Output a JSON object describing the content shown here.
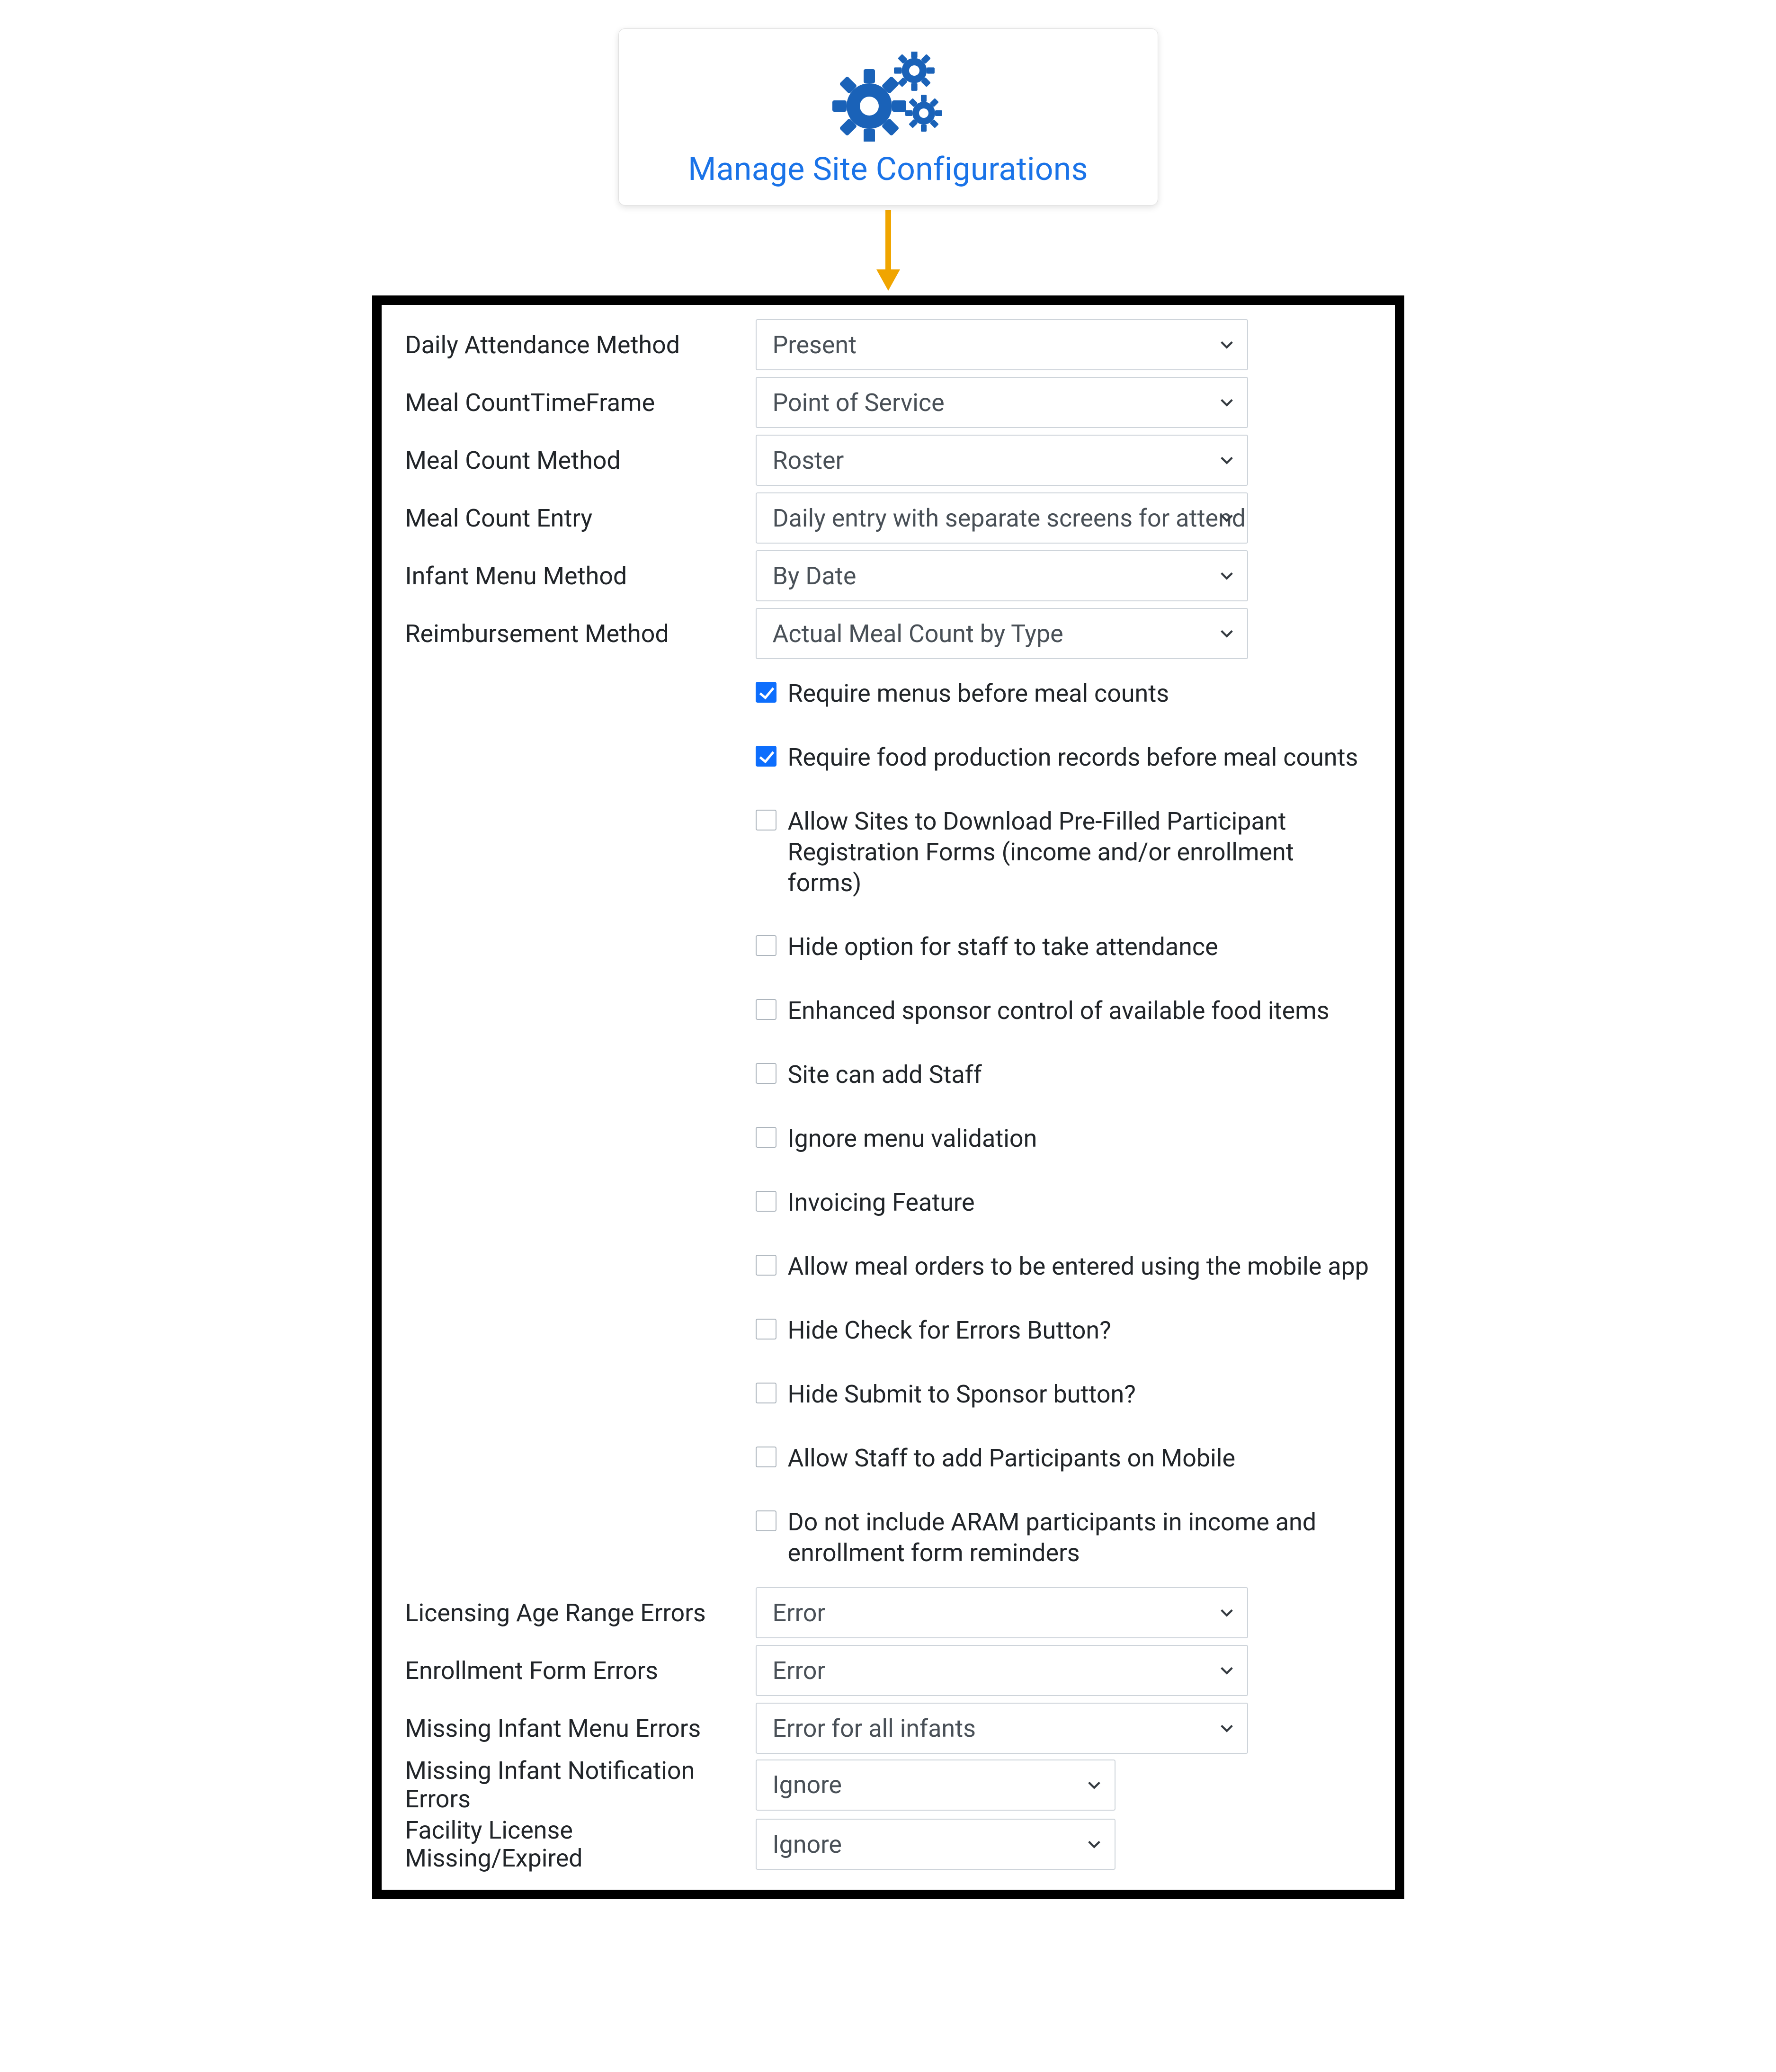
{
  "card": {
    "title": "Manage Site Configurations"
  },
  "fields": {
    "daily_attendance_method": {
      "label": "Daily Attendance Method",
      "value": "Present"
    },
    "meal_count_time_frame": {
      "label": "Meal CountTimeFrame",
      "value": "Point of Service"
    },
    "meal_count_method": {
      "label": "Meal Count Method",
      "value": "Roster"
    },
    "meal_count_entry": {
      "label": "Meal Count Entry",
      "value": "Daily entry with separate screens for attend"
    },
    "infant_menu_method": {
      "label": "Infant Menu Method",
      "value": "By Date"
    },
    "reimbursement_method": {
      "label": "Reimbursement Method",
      "value": "Actual Meal Count by Type"
    },
    "licensing_age_range_errors": {
      "label": "Licensing Age Range Errors",
      "value": "Error"
    },
    "enrollment_form_errors": {
      "label": "Enrollment Form Errors",
      "value": "Error"
    },
    "missing_infant_menu_errors": {
      "label": "Missing Infant Menu Errors",
      "value": "Error for all infants"
    },
    "missing_infant_notification_errors": {
      "label": "Missing Infant Notification Errors",
      "value": "Ignore"
    },
    "facility_license_missing_expired": {
      "label": "Facility License Missing/Expired",
      "value": "Ignore"
    }
  },
  "checkboxes": {
    "require_menus": {
      "label": "Require menus before meal counts",
      "checked": true
    },
    "require_food_production": {
      "label": "Require food production records before meal counts",
      "checked": true
    },
    "allow_download_prefilled": {
      "label": "Allow Sites to Download Pre-Filled Participant Registration Forms (income and/or enrollment forms)",
      "checked": false
    },
    "hide_staff_attendance": {
      "label": "Hide option for staff to take attendance",
      "checked": false
    },
    "enhanced_sponsor_control": {
      "label": "Enhanced sponsor control of available food items",
      "checked": false
    },
    "site_can_add_staff": {
      "label": "Site can add Staff",
      "checked": false
    },
    "ignore_menu_validation": {
      "label": "Ignore menu validation",
      "checked": false
    },
    "invoicing_feature": {
      "label": "Invoicing Feature",
      "checked": false
    },
    "allow_meal_orders_mobile": {
      "label": "Allow meal orders to be entered using the mobile app",
      "checked": false
    },
    "hide_check_errors": {
      "label": "Hide Check for Errors Button?",
      "checked": false
    },
    "hide_submit_sponsor": {
      "label": "Hide Submit to Sponsor button?",
      "checked": false
    },
    "allow_staff_add_participants_mobile": {
      "label": "Allow Staff to add Participants on Mobile",
      "checked": false
    },
    "exclude_aram": {
      "label": "Do not include ARAM participants in income and enrollment form reminders",
      "checked": false
    }
  }
}
